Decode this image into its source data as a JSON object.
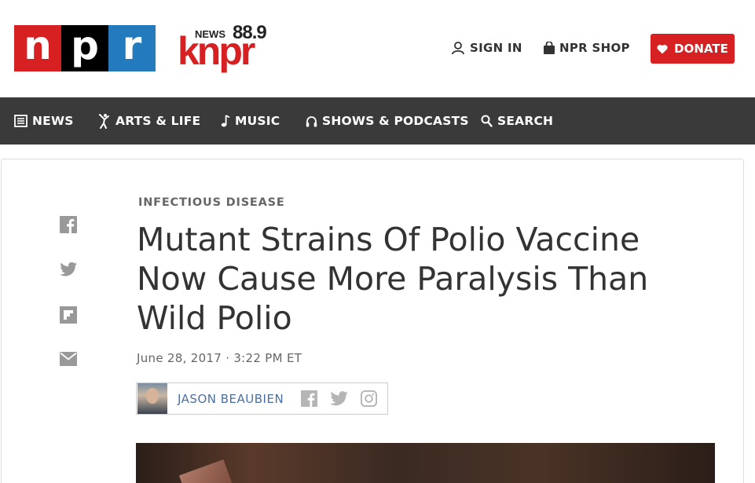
{
  "header": {
    "npr_logo": [
      "n",
      "p",
      "r"
    ],
    "station": {
      "news": "NEWS",
      "freq": "88.9",
      "name": "knpr"
    },
    "signin_label": "SIGN IN",
    "shop_label": "NPR SHOP",
    "donate_label": "DONATE"
  },
  "nav": {
    "items": [
      {
        "label": "NEWS",
        "icon": "list-icon"
      },
      {
        "label": "ARTS & LIFE",
        "icon": "dancer-icon"
      },
      {
        "label": "MUSIC",
        "icon": "music-note-icon"
      },
      {
        "label": "SHOWS & PODCASTS",
        "icon": "headphones-icon"
      },
      {
        "label": "SEARCH",
        "icon": "search-icon"
      }
    ]
  },
  "share": [
    "facebook-icon",
    "twitter-icon",
    "flipboard-icon",
    "email-icon"
  ],
  "article": {
    "kicker": "INFECTIOUS DISEASE",
    "title": "Mutant Strains Of Polio Vaccine Now Cause More Paralysis Than Wild Polio",
    "date": "June 28, 2017 · 3:22 PM ET",
    "author": "JASON BEAUBIEN"
  },
  "colors": {
    "npr_red": "#d62021",
    "npr_blue": "#237bbd",
    "nav_bg": "#3a3a3a",
    "link_blue": "#4a6fa5"
  }
}
